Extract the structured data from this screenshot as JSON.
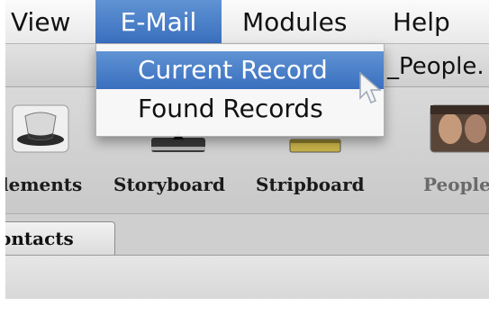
{
  "menubar": {
    "items": [
      {
        "label": "View",
        "active": false
      },
      {
        "label": "E-Mail",
        "active": true
      },
      {
        "label": "Modules",
        "active": false
      },
      {
        "label": "Help",
        "active": false
      }
    ]
  },
  "window": {
    "title": "_People."
  },
  "dropdown": {
    "items": [
      {
        "label": "Current Record",
        "selected": true
      },
      {
        "label": "Found Records",
        "selected": false
      }
    ]
  },
  "toolbar": {
    "items": [
      {
        "label": "lements",
        "icon": "top-hat-icon"
      },
      {
        "label": "Storyboard",
        "icon": "storyboard-icon"
      },
      {
        "label": "Stripboard",
        "icon": "stripboard-icon"
      },
      {
        "label": "People",
        "icon": "people-photo-icon"
      }
    ]
  },
  "tabs": [
    {
      "label": "ontacts"
    }
  ],
  "colors": {
    "selection_blue": "#4a80c8",
    "menubar_bg": "#f2f2f2"
  }
}
